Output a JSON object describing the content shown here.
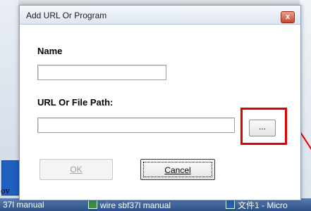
{
  "dialog": {
    "title": "Add URL Or Program",
    "close_glyph": "x",
    "name_label": "Name",
    "name_value": "",
    "path_label": "URL Or File Path:",
    "path_value": "",
    "browse_label": "...",
    "ok_label": "OK",
    "cancel_label": "Cancel"
  },
  "background": {
    "left_fragment": "ov",
    "taskbar_items": [
      "37l manual",
      "wire sbf37l manual",
      "文件1 - Micro"
    ]
  },
  "colors": {
    "highlight": "#e00000",
    "close_button": "#c74a2f",
    "taskbar": "#2a4f86"
  }
}
